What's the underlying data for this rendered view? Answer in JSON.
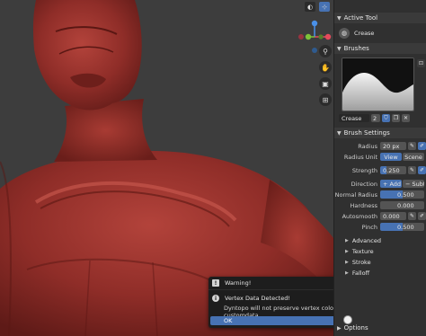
{
  "active_tool": {
    "header": "Active Tool",
    "tool_name": "Crease"
  },
  "brushes": {
    "header": "Brushes",
    "brush_name": "Crease",
    "user_count": "2"
  },
  "brush_settings": {
    "header": "Brush Settings",
    "radius": {
      "label": "Radius",
      "value": "20 px"
    },
    "radius_unit": {
      "label": "Radius Unit",
      "options": [
        "View",
        "Scene"
      ],
      "selected": "View"
    },
    "strength": {
      "label": "Strength",
      "value": "0.250",
      "fraction": 0.25
    },
    "direction": {
      "label": "Direction",
      "options": [
        "Add",
        "Subt"
      ],
      "selected": "Add"
    },
    "normal_radius": {
      "label": "Normal Radius",
      "value": "0.500",
      "fraction": 0.5
    },
    "hardness": {
      "label": "Hardness",
      "value": "0.000",
      "fraction": 0
    },
    "autosmooth": {
      "label": "Autosmooth",
      "value": "0.000",
      "fraction": 0
    },
    "pinch": {
      "label": "Pinch",
      "value": "0.500",
      "fraction": 0.5
    }
  },
  "subpanels": [
    "Advanced",
    "Texture",
    "Stroke",
    "Falloff"
  ],
  "options_label": "Options",
  "warning_popup": {
    "title": "Warning!",
    "message": "Vertex Data Detected!",
    "detail": "Dyntopo will not preserve vertex colors, UVs, or other customdata",
    "ok_label": "OK"
  },
  "gizmo_axes": {
    "x": "X",
    "y": "Y",
    "z": "Z"
  },
  "colors": {
    "accent": "#4772b3",
    "panel": "#303030",
    "model": "#8c2b26",
    "x_axis": "#e64a5b",
    "y_axis": "#7ec238",
    "z_axis": "#4a90e8"
  }
}
